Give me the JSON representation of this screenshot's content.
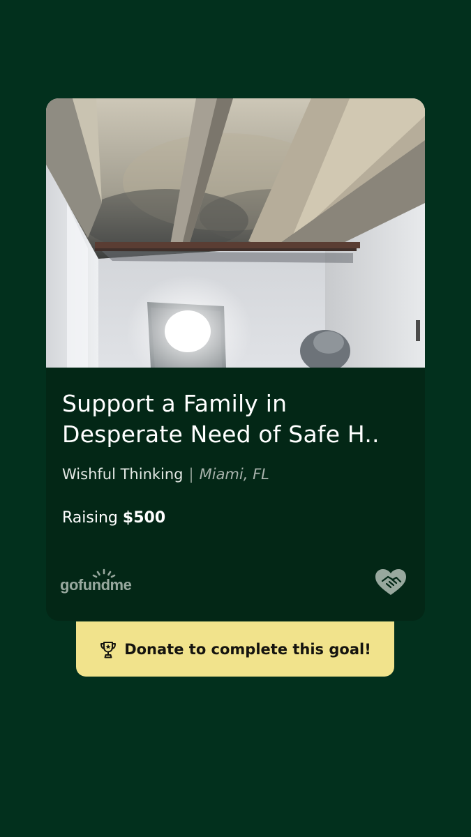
{
  "campaign": {
    "title_line1": "Support a Family in",
    "title_line2": "Desperate Need of Safe H..",
    "organizer": "Wishful Thinking",
    "separator": "|",
    "location": "Miami, FL",
    "raising_prefix": "Raising",
    "raising_amount": "$500"
  },
  "brand": {
    "name": "gofundme",
    "logo_icon": "sunrise-icon",
    "corner_icon": "heart-handshake-icon"
  },
  "cta": {
    "icon": "trophy-icon",
    "label": "Donate to complete this goal!"
  },
  "colors": {
    "background": "#02301d",
    "card": "#032716",
    "cta": "#f1e38c",
    "brand_muted": "#98a89e"
  }
}
